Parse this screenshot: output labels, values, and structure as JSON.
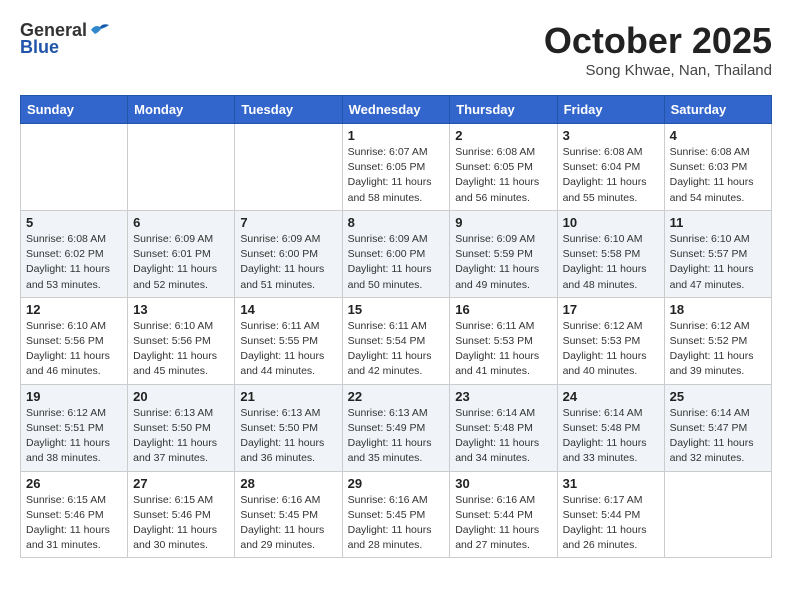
{
  "logo": {
    "general": "General",
    "blue": "Blue"
  },
  "header": {
    "title": "October 2025",
    "subtitle": "Song Khwae, Nan, Thailand"
  },
  "weekdays": [
    "Sunday",
    "Monday",
    "Tuesday",
    "Wednesday",
    "Thursday",
    "Friday",
    "Saturday"
  ],
  "weeks": [
    [
      {
        "day": "",
        "sunrise": "",
        "sunset": "",
        "daylight": ""
      },
      {
        "day": "",
        "sunrise": "",
        "sunset": "",
        "daylight": ""
      },
      {
        "day": "",
        "sunrise": "",
        "sunset": "",
        "daylight": ""
      },
      {
        "day": "1",
        "sunrise": "Sunrise: 6:07 AM",
        "sunset": "Sunset: 6:05 PM",
        "daylight": "Daylight: 11 hours and 58 minutes."
      },
      {
        "day": "2",
        "sunrise": "Sunrise: 6:08 AM",
        "sunset": "Sunset: 6:05 PM",
        "daylight": "Daylight: 11 hours and 56 minutes."
      },
      {
        "day": "3",
        "sunrise": "Sunrise: 6:08 AM",
        "sunset": "Sunset: 6:04 PM",
        "daylight": "Daylight: 11 hours and 55 minutes."
      },
      {
        "day": "4",
        "sunrise": "Sunrise: 6:08 AM",
        "sunset": "Sunset: 6:03 PM",
        "daylight": "Daylight: 11 hours and 54 minutes."
      }
    ],
    [
      {
        "day": "5",
        "sunrise": "Sunrise: 6:08 AM",
        "sunset": "Sunset: 6:02 PM",
        "daylight": "Daylight: 11 hours and 53 minutes."
      },
      {
        "day": "6",
        "sunrise": "Sunrise: 6:09 AM",
        "sunset": "Sunset: 6:01 PM",
        "daylight": "Daylight: 11 hours and 52 minutes."
      },
      {
        "day": "7",
        "sunrise": "Sunrise: 6:09 AM",
        "sunset": "Sunset: 6:00 PM",
        "daylight": "Daylight: 11 hours and 51 minutes."
      },
      {
        "day": "8",
        "sunrise": "Sunrise: 6:09 AM",
        "sunset": "Sunset: 6:00 PM",
        "daylight": "Daylight: 11 hours and 50 minutes."
      },
      {
        "day": "9",
        "sunrise": "Sunrise: 6:09 AM",
        "sunset": "Sunset: 5:59 PM",
        "daylight": "Daylight: 11 hours and 49 minutes."
      },
      {
        "day": "10",
        "sunrise": "Sunrise: 6:10 AM",
        "sunset": "Sunset: 5:58 PM",
        "daylight": "Daylight: 11 hours and 48 minutes."
      },
      {
        "day": "11",
        "sunrise": "Sunrise: 6:10 AM",
        "sunset": "Sunset: 5:57 PM",
        "daylight": "Daylight: 11 hours and 47 minutes."
      }
    ],
    [
      {
        "day": "12",
        "sunrise": "Sunrise: 6:10 AM",
        "sunset": "Sunset: 5:56 PM",
        "daylight": "Daylight: 11 hours and 46 minutes."
      },
      {
        "day": "13",
        "sunrise": "Sunrise: 6:10 AM",
        "sunset": "Sunset: 5:56 PM",
        "daylight": "Daylight: 11 hours and 45 minutes."
      },
      {
        "day": "14",
        "sunrise": "Sunrise: 6:11 AM",
        "sunset": "Sunset: 5:55 PM",
        "daylight": "Daylight: 11 hours and 44 minutes."
      },
      {
        "day": "15",
        "sunrise": "Sunrise: 6:11 AM",
        "sunset": "Sunset: 5:54 PM",
        "daylight": "Daylight: 11 hours and 42 minutes."
      },
      {
        "day": "16",
        "sunrise": "Sunrise: 6:11 AM",
        "sunset": "Sunset: 5:53 PM",
        "daylight": "Daylight: 11 hours and 41 minutes."
      },
      {
        "day": "17",
        "sunrise": "Sunrise: 6:12 AM",
        "sunset": "Sunset: 5:53 PM",
        "daylight": "Daylight: 11 hours and 40 minutes."
      },
      {
        "day": "18",
        "sunrise": "Sunrise: 6:12 AM",
        "sunset": "Sunset: 5:52 PM",
        "daylight": "Daylight: 11 hours and 39 minutes."
      }
    ],
    [
      {
        "day": "19",
        "sunrise": "Sunrise: 6:12 AM",
        "sunset": "Sunset: 5:51 PM",
        "daylight": "Daylight: 11 hours and 38 minutes."
      },
      {
        "day": "20",
        "sunrise": "Sunrise: 6:13 AM",
        "sunset": "Sunset: 5:50 PM",
        "daylight": "Daylight: 11 hours and 37 minutes."
      },
      {
        "day": "21",
        "sunrise": "Sunrise: 6:13 AM",
        "sunset": "Sunset: 5:50 PM",
        "daylight": "Daylight: 11 hours and 36 minutes."
      },
      {
        "day": "22",
        "sunrise": "Sunrise: 6:13 AM",
        "sunset": "Sunset: 5:49 PM",
        "daylight": "Daylight: 11 hours and 35 minutes."
      },
      {
        "day": "23",
        "sunrise": "Sunrise: 6:14 AM",
        "sunset": "Sunset: 5:48 PM",
        "daylight": "Daylight: 11 hours and 34 minutes."
      },
      {
        "day": "24",
        "sunrise": "Sunrise: 6:14 AM",
        "sunset": "Sunset: 5:48 PM",
        "daylight": "Daylight: 11 hours and 33 minutes."
      },
      {
        "day": "25",
        "sunrise": "Sunrise: 6:14 AM",
        "sunset": "Sunset: 5:47 PM",
        "daylight": "Daylight: 11 hours and 32 minutes."
      }
    ],
    [
      {
        "day": "26",
        "sunrise": "Sunrise: 6:15 AM",
        "sunset": "Sunset: 5:46 PM",
        "daylight": "Daylight: 11 hours and 31 minutes."
      },
      {
        "day": "27",
        "sunrise": "Sunrise: 6:15 AM",
        "sunset": "Sunset: 5:46 PM",
        "daylight": "Daylight: 11 hours and 30 minutes."
      },
      {
        "day": "28",
        "sunrise": "Sunrise: 6:16 AM",
        "sunset": "Sunset: 5:45 PM",
        "daylight": "Daylight: 11 hours and 29 minutes."
      },
      {
        "day": "29",
        "sunrise": "Sunrise: 6:16 AM",
        "sunset": "Sunset: 5:45 PM",
        "daylight": "Daylight: 11 hours and 28 minutes."
      },
      {
        "day": "30",
        "sunrise": "Sunrise: 6:16 AM",
        "sunset": "Sunset: 5:44 PM",
        "daylight": "Daylight: 11 hours and 27 minutes."
      },
      {
        "day": "31",
        "sunrise": "Sunrise: 6:17 AM",
        "sunset": "Sunset: 5:44 PM",
        "daylight": "Daylight: 11 hours and 26 minutes."
      },
      {
        "day": "",
        "sunrise": "",
        "sunset": "",
        "daylight": ""
      }
    ]
  ]
}
